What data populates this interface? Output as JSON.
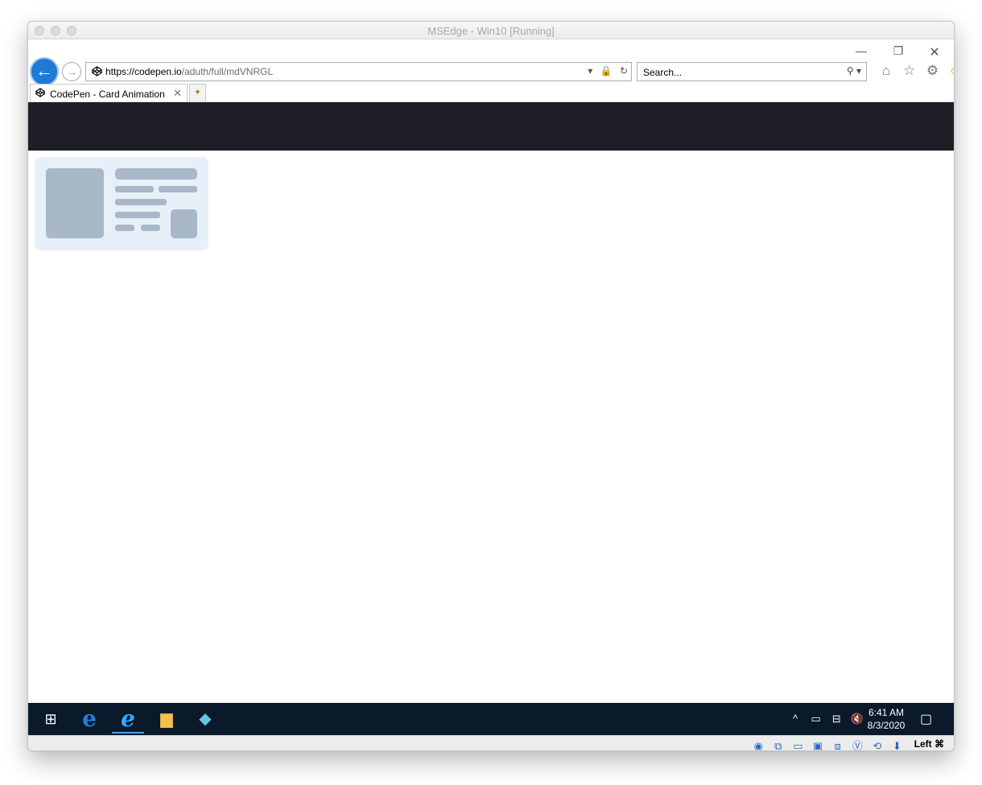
{
  "window": {
    "title": "MSEdge - Win10 [Running]"
  },
  "window_controls": {
    "minimize": "—",
    "restore": "❐",
    "close": "✕"
  },
  "nav": {
    "back": "←",
    "forward": "→"
  },
  "address": {
    "site_icon": "codepen-icon",
    "url_base": "https://codepen.io",
    "url_path": "/aduth/full/mdVNRGL",
    "dropdown": "▾",
    "lock": "🔒",
    "refresh": "↻"
  },
  "search": {
    "placeholder": "Search...",
    "go": "⚲ ▾"
  },
  "toolbar": {
    "home": "⌂",
    "favorites": "☆",
    "settings": "⚙",
    "feedback": "☺"
  },
  "tabs": [
    {
      "title": "CodePen - Card Animation",
      "close": "✕"
    }
  ],
  "new_tab": "✦",
  "taskbar": {
    "start": "⊞",
    "edge": "e",
    "ie": "e",
    "files": "▆",
    "app": "◆",
    "tray": {
      "chevron": "^",
      "battery": "▭",
      "network": "⊟",
      "volume": "🔇"
    },
    "time": "6:41 AM",
    "date": "8/3/2020",
    "notifications": "▢"
  },
  "vbox": {
    "icons": [
      "◉",
      "⧉",
      "▭",
      "▣",
      "⧈",
      "Ⓥ",
      "⟲",
      "⬇"
    ],
    "host_key": "Left ⌘"
  }
}
